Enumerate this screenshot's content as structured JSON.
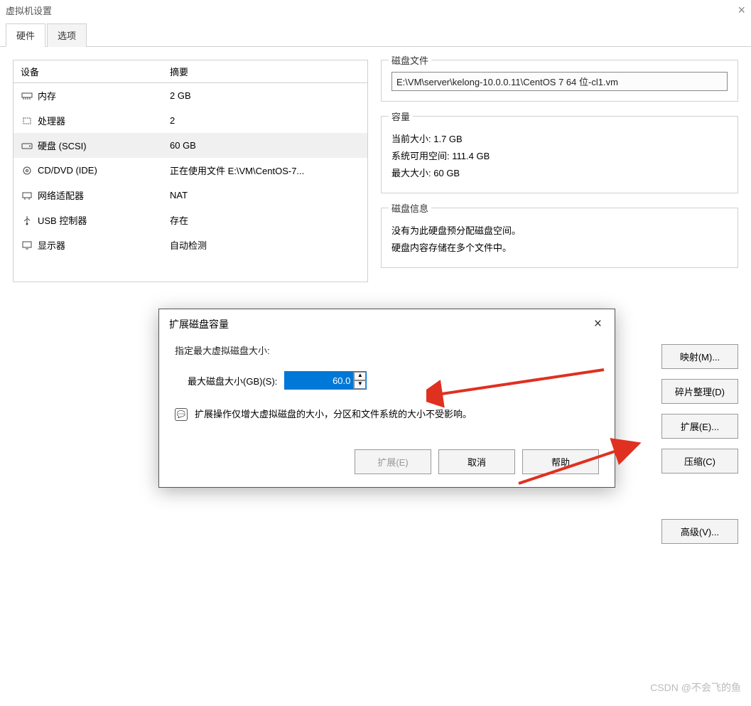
{
  "window": {
    "title": "虚拟机设置"
  },
  "tabs": {
    "hardware": "硬件",
    "options": "选项"
  },
  "device_table": {
    "col_device": "设备",
    "col_summary": "摘要",
    "rows": [
      {
        "icon": "memory-icon",
        "name": "内存",
        "summary": "2 GB"
      },
      {
        "icon": "cpu-icon",
        "name": "处理器",
        "summary": "2"
      },
      {
        "icon": "disk-icon",
        "name": "硬盘 (SCSI)",
        "summary": "60 GB",
        "selected": true
      },
      {
        "icon": "cd-icon",
        "name": "CD/DVD (IDE)",
        "summary": "正在使用文件 E:\\VM\\CentOS-7..."
      },
      {
        "icon": "net-icon",
        "name": "网络适配器",
        "summary": "NAT"
      },
      {
        "icon": "usb-icon",
        "name": "USB 控制器",
        "summary": "存在"
      },
      {
        "icon": "display-icon",
        "name": "显示器",
        "summary": "自动检测"
      }
    ]
  },
  "disk_file": {
    "legend": "磁盘文件",
    "value": "E:\\VM\\server\\kelong-10.0.0.11\\CentOS 7 64 位-cl1.vm"
  },
  "capacity": {
    "legend": "容量",
    "current_label": "当前大小:",
    "current_value": "1.7 GB",
    "free_label": "系统可用空间:",
    "free_value": "111.4 GB",
    "max_label": "最大大小:",
    "max_value": "60 GB"
  },
  "disk_info": {
    "legend": "磁盘信息",
    "line1": "没有为此硬盘预分配磁盘空间。",
    "line2": "硬盘内容存储在多个文件中。"
  },
  "side_buttons": {
    "map": "映射(M)...",
    "defrag": "碎片整理(D)",
    "expand": "扩展(E)...",
    "compact": "压缩(C)",
    "advanced": "高级(V)..."
  },
  "modal": {
    "title": "扩展磁盘容量",
    "specify": "指定最大虚拟磁盘大小:",
    "size_label": "最大磁盘大小(GB)(S):",
    "size_value": "60.0",
    "note": "扩展操作仅增大虚拟磁盘的大小，分区和文件系统的大小不受影响。",
    "btn_expand": "扩展(E)",
    "btn_cancel": "取消",
    "btn_help": "帮助"
  },
  "watermark": "CSDN @不会飞的鱼"
}
